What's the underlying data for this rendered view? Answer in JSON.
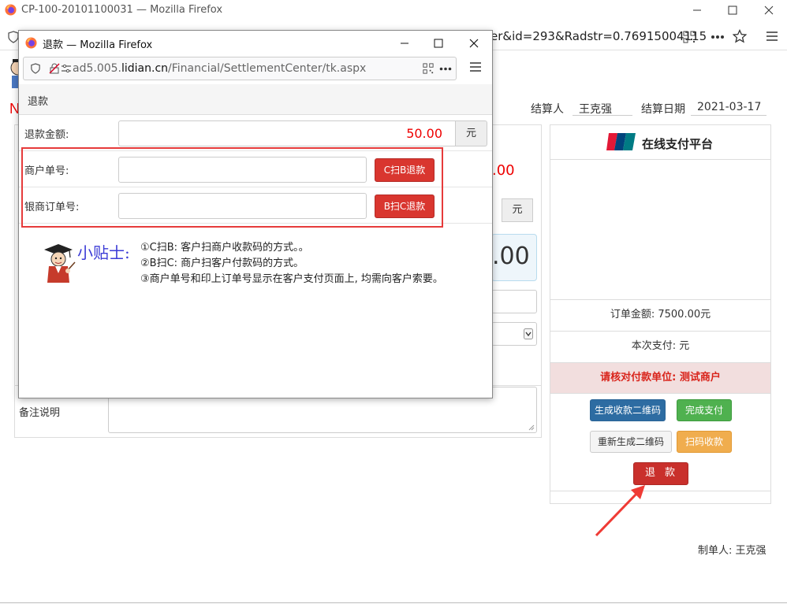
{
  "outer_window": {
    "title": "CP-100-20101100031 — Mozilla Firefox",
    "url_tail": "er&id=293&Radstr=0.76915004115"
  },
  "settlement": {
    "settler_label": "结算人",
    "settler_name": "王克强",
    "date_label": "结算日期",
    "date_value": "2021-03-17"
  },
  "background_form": {
    "red_amount_fragment": ".00",
    "big_amount_fragment": ".00",
    "yuan_addon": "元",
    "remark_label": "备注说明",
    "red_mark": "N"
  },
  "payment_panel": {
    "title": "在线支付平台",
    "order_amount": "订单金额:  7500.00元",
    "current_payment": "本次支付:  元",
    "verify_notice": "请核对付款单位: 测试商户",
    "buttons": {
      "generate_qr": "生成收款二维码",
      "complete_payment": "完成支付",
      "regenerate_qr": "重新生成二维码",
      "scan_collect": "扫码收款",
      "refund": "退款"
    }
  },
  "maker": "制单人: 王克强",
  "popup": {
    "window_title": "退款 — Mozilla Firefox",
    "url_prefix": "ad5.005.",
    "url_domain": "lidian.cn",
    "url_path": "/Financial/SettlementCenter/tk.aspx",
    "heading": "退款",
    "amount_label": "退款金额:",
    "amount_value": "50.00",
    "amount_unit": "元",
    "merchant_no_label": "商户单号:",
    "merchant_no_value": "",
    "c_scan_b_button": "C扫B退款",
    "unionpay_order_label": "银商订单号:",
    "unionpay_order_value": "",
    "b_scan_c_button": "B扫C退款",
    "tips_title": "小贴士:",
    "tips": [
      "①C扫B: 客户扫商户收款码的方式。。",
      "②B扫C: 商户扫客户付款码的方式。",
      "③商户单号和印上订单号显示在客户支付页面上, 均需向客户索要。"
    ]
  },
  "colors": {
    "accent_red": "#d9362f",
    "highlight_border": "#e63b3b",
    "tip_blue": "#3b3bd6"
  }
}
